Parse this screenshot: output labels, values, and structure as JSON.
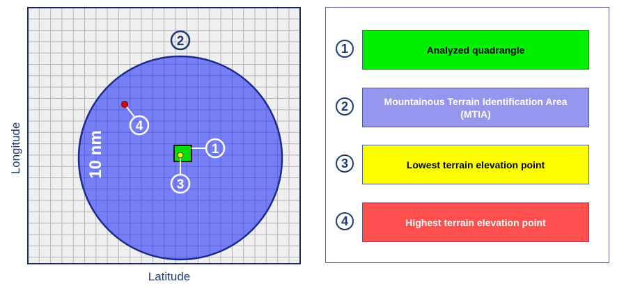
{
  "axes": {
    "xlabel": "Latitude",
    "ylabel": "Longitude"
  },
  "diagram": {
    "radius_label": "10 nm",
    "markers": [
      "1",
      "2",
      "3",
      "4"
    ]
  },
  "legend": [
    {
      "number": "1",
      "label": "Analyzed quadrangle",
      "color": "#00f000",
      "text_color": "#000000"
    },
    {
      "number": "2",
      "label": "Mountainous Terrain Identification Area (MTIA)",
      "color": "#9696ef",
      "text_color": "#ffffff"
    },
    {
      "number": "3",
      "label": "Lowest terrain elevation point",
      "color": "#ffff00",
      "text_color": "#000000"
    },
    {
      "number": "4",
      "label": "Highest terrain elevation point",
      "color": "#ff4f4f",
      "text_color": "#ffffff"
    }
  ],
  "colors": {
    "grid_background": "#efefef",
    "grid_lines": "#b5b5b5",
    "circle_fill": "#6f78f4",
    "circle_stroke": "#1c2a8a",
    "marker_color": "#1f3a73",
    "highest_point": "#e00000",
    "lowest_point": "#ffff00"
  }
}
